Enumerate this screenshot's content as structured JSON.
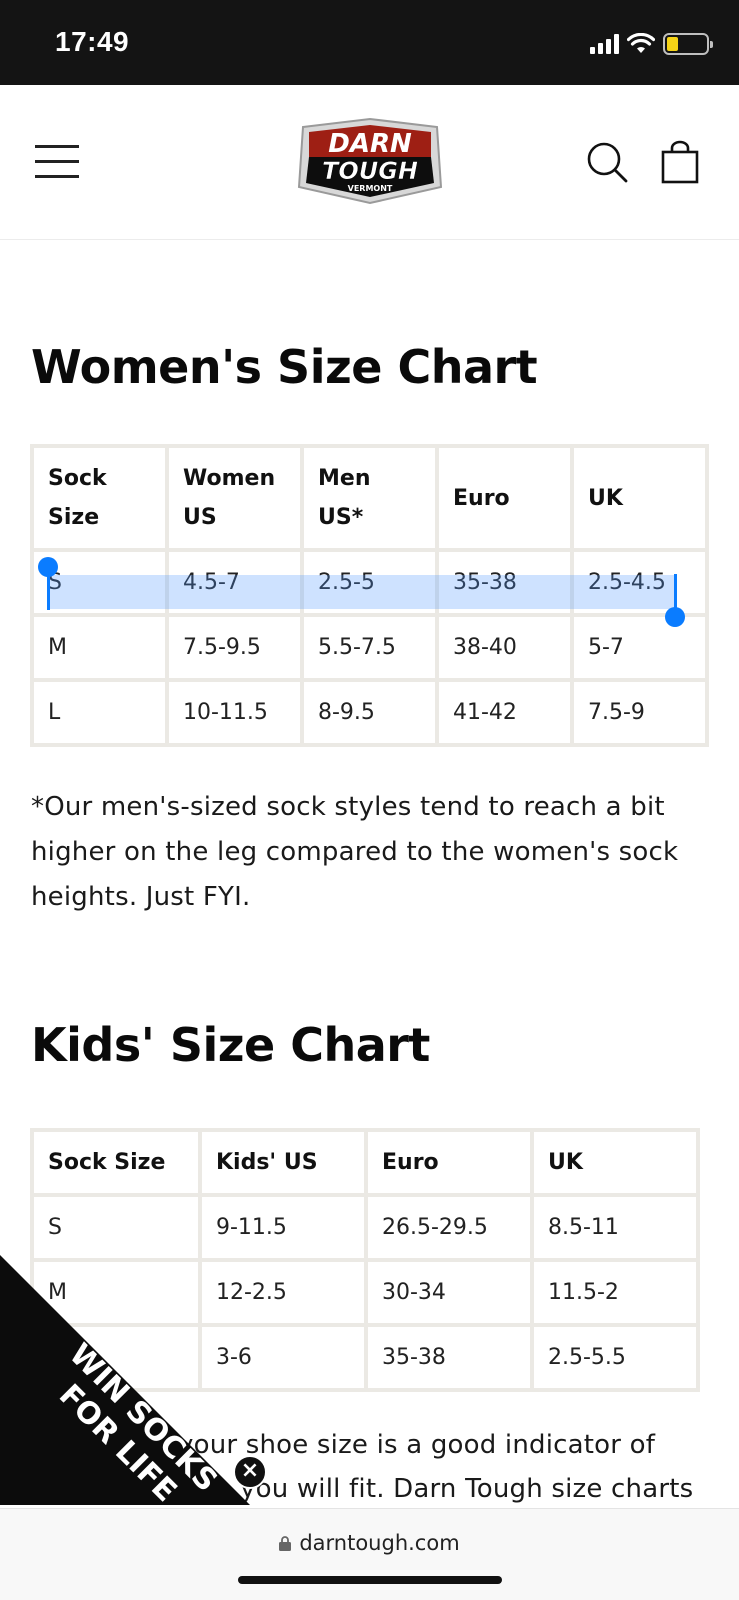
{
  "status_bar": {
    "time": "17:49"
  },
  "header": {
    "logo_line1": "DARN",
    "logo_line2": "TOUGH",
    "logo_line3": "VERMONT"
  },
  "women": {
    "title": "Women's Size Chart",
    "headers": [
      "Sock\nSize",
      "Women\nUS",
      "Men\nUS*",
      "Euro",
      "UK"
    ],
    "rows": [
      [
        "S",
        "4.5-7",
        "2.5-5",
        "35-38",
        "2.5-4.5"
      ],
      [
        "M",
        "7.5-9.5",
        "5.5-7.5",
        "38-40",
        "5-7"
      ],
      [
        "L",
        "10-11.5",
        "8-9.5",
        "41-42",
        "7.5-9"
      ]
    ],
    "note": "*Our men's-sized sock styles tend to reach a bit higher on the leg compared to the women's sock heights. Just FYI."
  },
  "kids": {
    "title": "Kids' Size Chart",
    "headers": [
      "Sock Size",
      "Kids' US",
      "Euro",
      "UK"
    ],
    "rows": [
      [
        "S",
        "9-11.5",
        "26.5-29.5",
        "8.5-11"
      ],
      [
        "M",
        "12-2.5",
        "30-34",
        "11.5-2"
      ],
      [
        "",
        "3-6",
        "35-38",
        "2.5-5.5"
      ]
    ],
    "note_line1": "your shoe size is a good indicator of",
    "note_line2": "you will fit. Darn Tough size charts"
  },
  "promo": {
    "line1": "WIN SOCKS",
    "line2": "FOR LIFE"
  },
  "url_bar": {
    "url": "darntough.com"
  }
}
